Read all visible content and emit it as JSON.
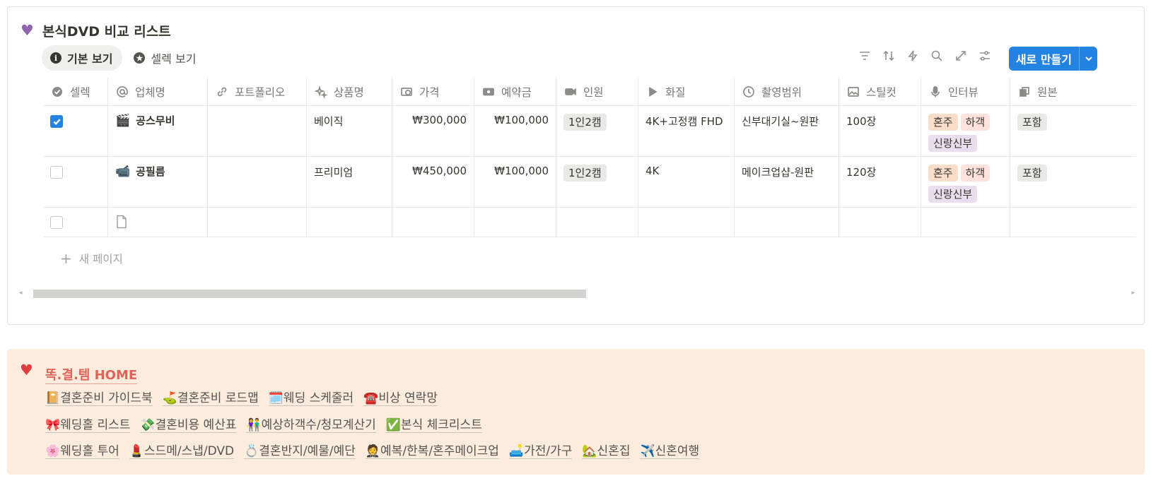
{
  "database": {
    "title": "본식DVD 비교 리스트",
    "title_icon": "purple-heart",
    "views": [
      {
        "label": "기본 보기",
        "icon": "info-icon",
        "active": true
      },
      {
        "label": "셀렉 보기",
        "icon": "star-icon",
        "active": false
      }
    ],
    "toolbar": {
      "icons": [
        "filter-icon",
        "sort-icon",
        "lightning-icon",
        "search-icon",
        "expand-icon",
        "settings-icon"
      ],
      "new_button_label": "새로 만들기"
    },
    "columns": [
      {
        "label": "셀렉",
        "icon": "check-circle-icon"
      },
      {
        "label": "업체명",
        "icon": "at-icon"
      },
      {
        "label": "포트폴리오",
        "icon": "link-icon"
      },
      {
        "label": "상품명",
        "icon": "sparkle-icon"
      },
      {
        "label": "가격",
        "icon": "money-icon"
      },
      {
        "label": "예약금",
        "icon": "cash-icon"
      },
      {
        "label": "인원",
        "icon": "video-icon"
      },
      {
        "label": "화질",
        "icon": "play-icon"
      },
      {
        "label": "촬영범위",
        "icon": "clock-icon"
      },
      {
        "label": "스틸컷",
        "icon": "image-icon"
      },
      {
        "label": "인터뷰",
        "icon": "mic-icon"
      },
      {
        "label": "원본",
        "icon": "copy-icon"
      }
    ],
    "rows": [
      {
        "selected": true,
        "emoji": "🎬",
        "name": "공스무비",
        "portfolio": "",
        "product": "베이직",
        "price": "₩300,000",
        "deposit": "₩100,000",
        "people": "1인2캠",
        "quality": "4K+고정캠 FHD",
        "range": "신부대기실~원판",
        "stills": "100장",
        "interview": [
          "혼주",
          "하객",
          "신랑신부"
        ],
        "original": "포함"
      },
      {
        "selected": false,
        "emoji": "📹",
        "name": "공필름",
        "portfolio": "",
        "product": "프리미엄",
        "price": "₩450,000",
        "deposit": "₩100,000",
        "people": "1인2캠",
        "quality": "4K",
        "range": "메이크업샵-원판",
        "stills": "120장",
        "interview": [
          "혼주",
          "하객",
          "신랑신부"
        ],
        "original": "포함"
      }
    ],
    "new_page_label": "새 페이지"
  },
  "callout": {
    "icon": "red-heart",
    "home_label": "똑.결.템 HOME",
    "links": [
      [
        "📔결혼준비 가이드북",
        "⛳결혼준비 로드맵",
        "🗓️웨딩 스케줄러",
        "☎️비상 연락망"
      ],
      [
        "🎀웨딩홀 리스트",
        "💸결혼비용 예산표",
        "👫예상하객수/청모계산기",
        "✅본식 체크리스트"
      ],
      [
        "🌸웨딩홀 투어",
        "💄스드메/스냅/DVD",
        "💍결혼반지/예물/예단",
        "🤵예복/한복/혼주메이크업",
        "🛋️가전/가구",
        "🏡신혼집",
        "✈️신혼여행"
      ]
    ]
  },
  "colors": {
    "accent": "#2383e2",
    "callout_bg": "#fbecdd",
    "home_link": "#e16259"
  }
}
